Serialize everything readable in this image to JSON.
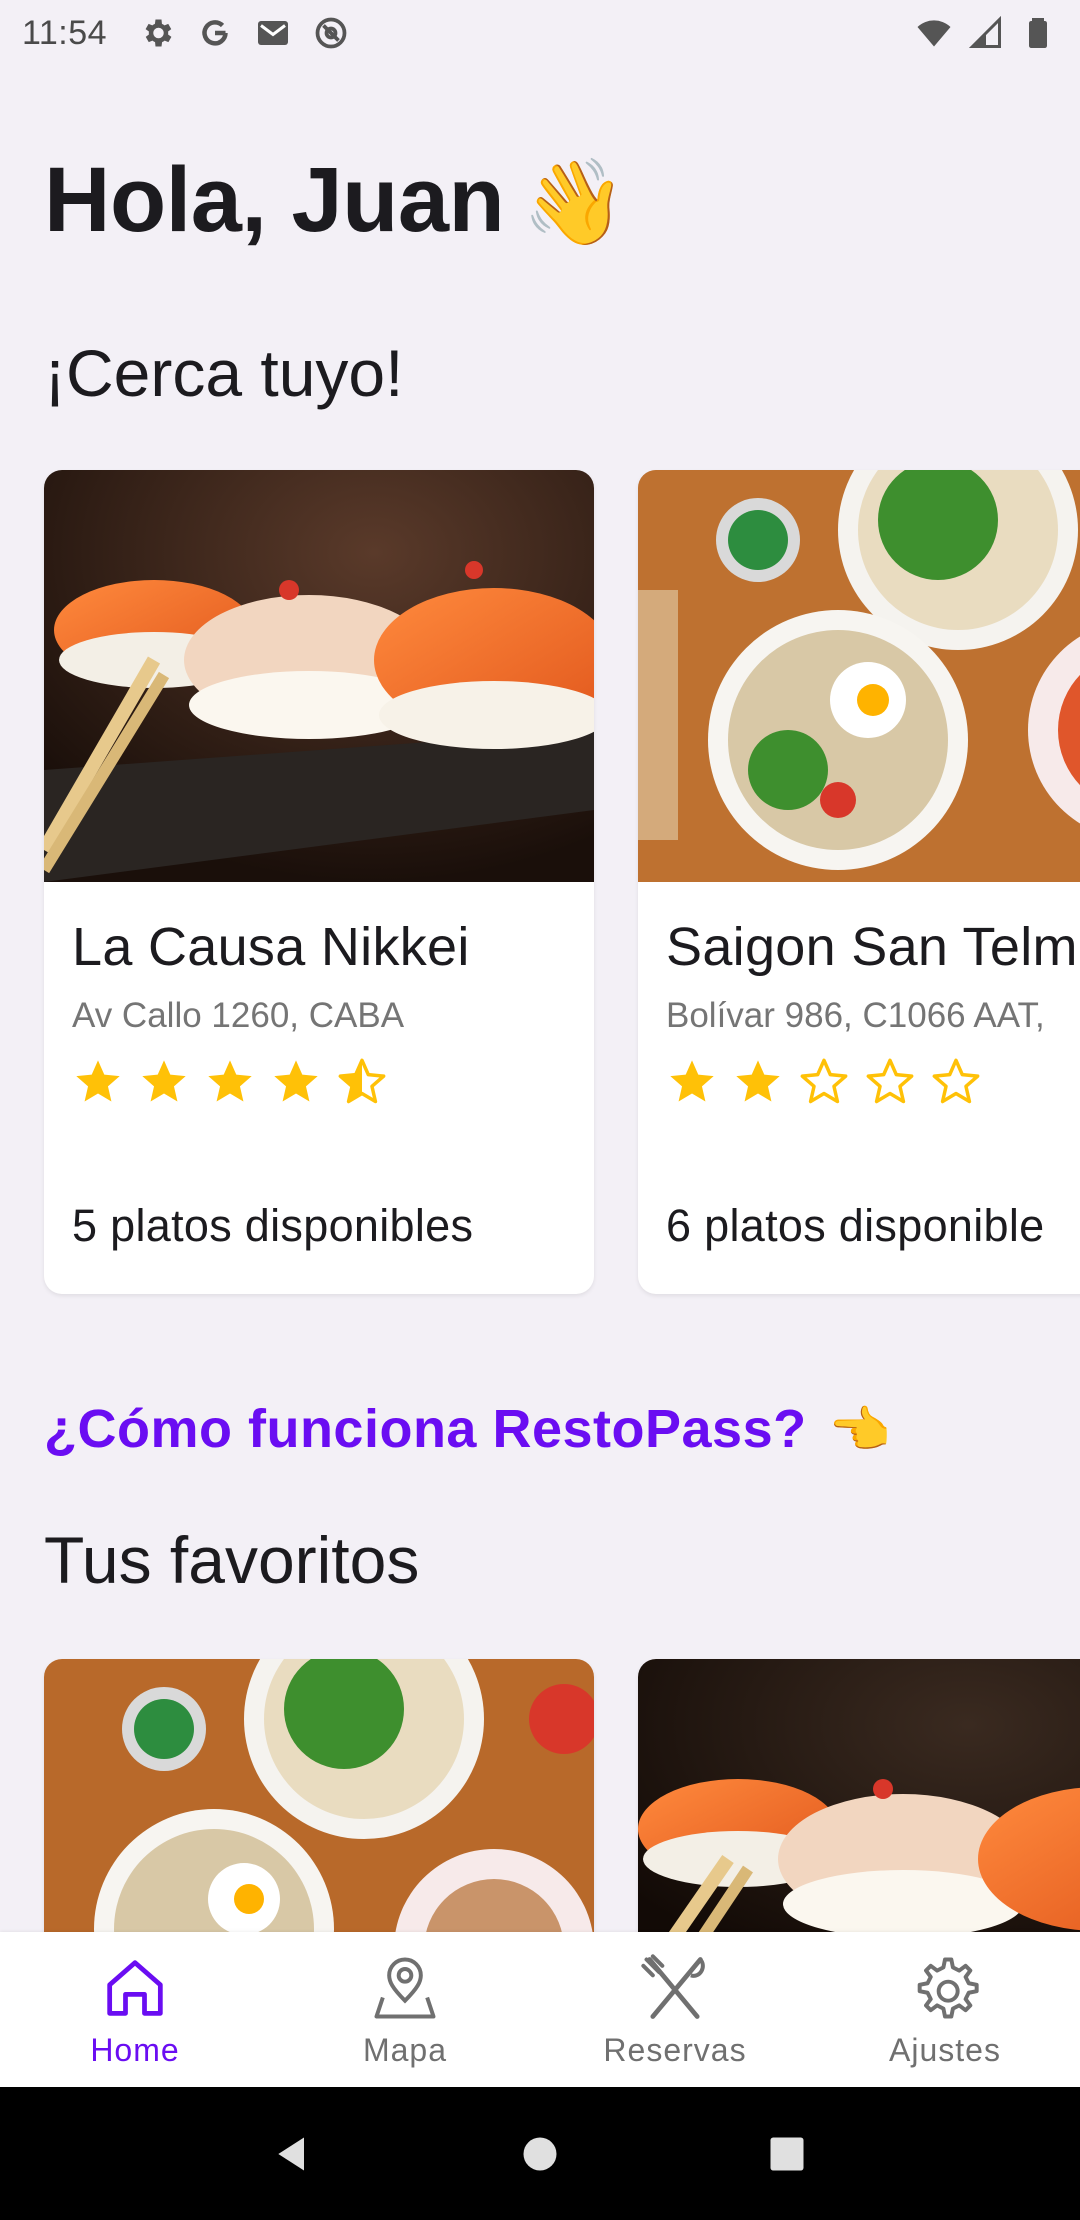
{
  "status_bar": {
    "time": "11:54",
    "left_icons": [
      "settings-icon",
      "google-icon",
      "gmail-icon",
      "at-sign-icon"
    ],
    "right_icons": [
      "wifi-icon",
      "signal-icon",
      "battery-icon"
    ]
  },
  "header": {
    "greeting": "Hola, Juan",
    "wave_emoji": "👋"
  },
  "near_section": {
    "title": "¡Cerca tuyo!",
    "cards": [
      {
        "name": "La Causa Nikkei",
        "address": "Av Callo 1260, CABA",
        "rating": 4.5,
        "dishes": "5 platos disponibles",
        "image": "sushi-photo"
      },
      {
        "name": "Saigon San Telm",
        "address": "Bolívar 986, C1066 AAT,",
        "rating": 2,
        "dishes": "6 platos disponible",
        "image": "pho-bowls-photo"
      }
    ]
  },
  "how_link": {
    "label": "¿Cómo funciona RestoPass?",
    "emoji": "👈"
  },
  "favorites_section": {
    "title": "Tus favoritos",
    "cards": [
      {
        "image": "pho-bowls-photo"
      },
      {
        "image": "sushi-photo"
      }
    ]
  },
  "bottom_nav": {
    "items": [
      {
        "label": "Home",
        "icon": "home-icon",
        "active": true
      },
      {
        "label": "Mapa",
        "icon": "map-pin-icon",
        "active": false
      },
      {
        "label": "Reservas",
        "icon": "fork-knife-icon",
        "active": false
      },
      {
        "label": "Ajustes",
        "icon": "gear-icon",
        "active": false
      }
    ]
  },
  "colors": {
    "accent": "#6a0df2",
    "background": "#f3f0f6",
    "star": "#ffc107",
    "text_primary": "#1c1b1f",
    "text_secondary": "#757575"
  }
}
